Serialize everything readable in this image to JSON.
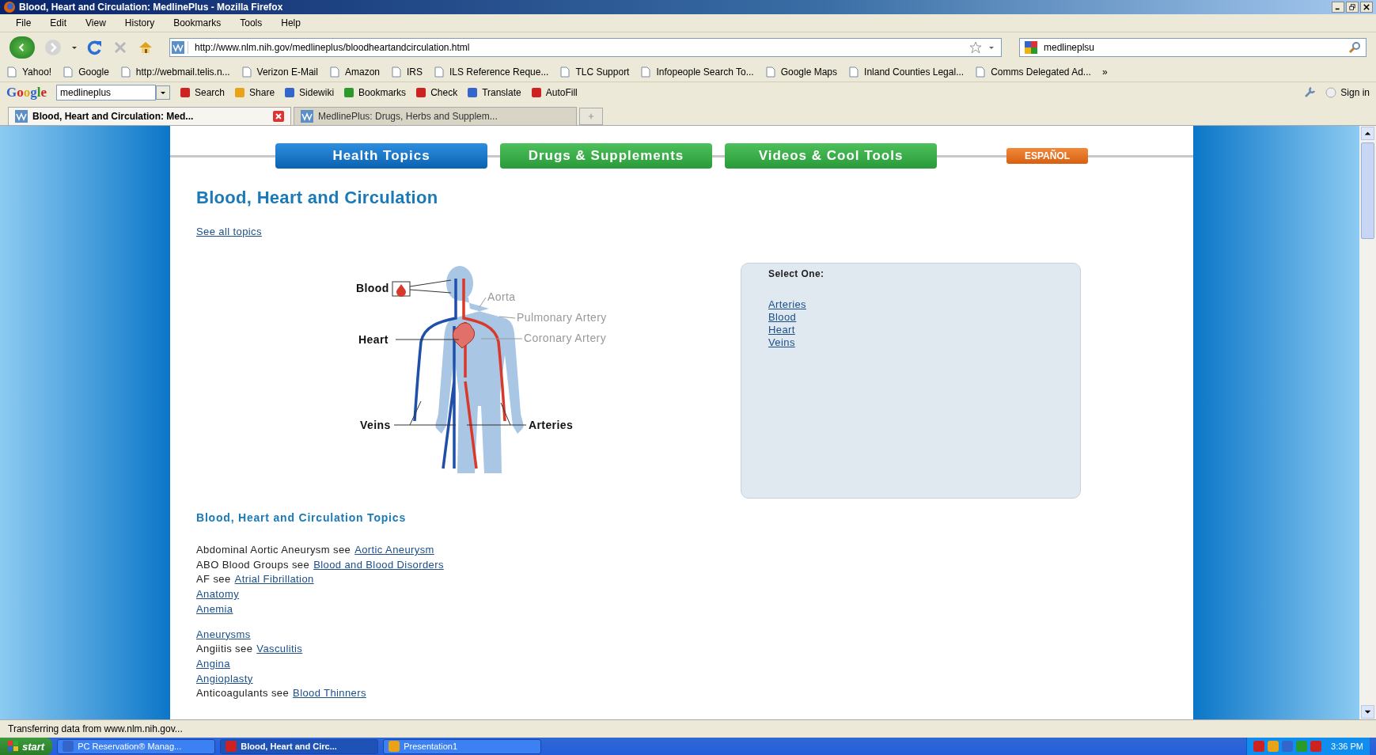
{
  "window": {
    "title": "Blood, Heart and Circulation: MedlinePlus - Mozilla Firefox"
  },
  "menu": [
    "File",
    "Edit",
    "View",
    "History",
    "Bookmarks",
    "Tools",
    "Help"
  ],
  "navigation": {
    "url": "http://www.nlm.nih.gov/medlineplus/bloodheartandcirculation.html",
    "search_value": "medlineplsu"
  },
  "bookmarks": [
    "Yahoo!",
    "Google",
    "http://webmail.telis.n...",
    "Verizon E-Mail",
    "Amazon",
    "IRS",
    "ILS Reference Reque...",
    "TLC Support",
    "Infopeople Search To...",
    "Google Maps",
    "Inland Counties Legal...",
    "Comms Delegated Ad...",
    "»"
  ],
  "google_toolbar": {
    "logo": "Google",
    "search_value": "medlineplus",
    "items": [
      "Search",
      "Share",
      "Sidewiki",
      "Bookmarks",
      "Check",
      "Translate",
      "AutoFill"
    ],
    "sign_in": "Sign in"
  },
  "tabs": [
    {
      "label": "Blood, Heart and Circulation: Med...",
      "selected": true
    },
    {
      "label": "MedlinePlus: Drugs, Herbs and Supplem...",
      "selected": false
    }
  ],
  "page": {
    "nav_tabs": [
      {
        "label": "Health Topics",
        "selected": true
      },
      {
        "label": "Drugs & Supplements",
        "selected": false
      },
      {
        "label": "Videos & Cool Tools",
        "selected": false
      }
    ],
    "language_button": "ESPAÑOL",
    "heading": "Blood, Heart and Circulation",
    "see_all": "See all topics",
    "diagram_labels": [
      "Blood",
      "Heart",
      "Veins",
      "Arteries",
      "Aorta",
      "Pulmonary Artery",
      "Coronary Artery"
    ],
    "select_box": {
      "title": "Select One:",
      "links": [
        "Arteries",
        "Blood",
        "Heart",
        "Veins"
      ]
    },
    "topics_heading": "Blood, Heart and Circulation Topics",
    "topic_groups": [
      [
        {
          "text": "Abdominal Aortic Aneurysm see",
          "link": "Aortic Aneurysm"
        },
        {
          "text": "ABO Blood Groups see",
          "link": "Blood and Blood Disorders"
        },
        {
          "text": "AF see",
          "link": "Atrial Fibrillation"
        },
        {
          "link": "Anatomy"
        },
        {
          "link": "Anemia"
        }
      ],
      [
        {
          "link": "Aneurysms"
        },
        {
          "text": "Angiitis see",
          "link": "Vasculitis"
        },
        {
          "link": "Angina"
        },
        {
          "link": "Angioplasty"
        },
        {
          "text": "Anticoagulants see",
          "link": "Blood Thinners"
        }
      ]
    ]
  },
  "status_bar": "Transferring data from www.nlm.nih.gov...",
  "taskbar": {
    "start": "start",
    "items": [
      {
        "label": "PC Reservation® Manag...",
        "selected": false
      },
      {
        "label": "Blood, Heart and Circ...",
        "selected": true
      },
      {
        "label": "Presentation1",
        "selected": false
      }
    ],
    "clock": "3:36 PM"
  }
}
